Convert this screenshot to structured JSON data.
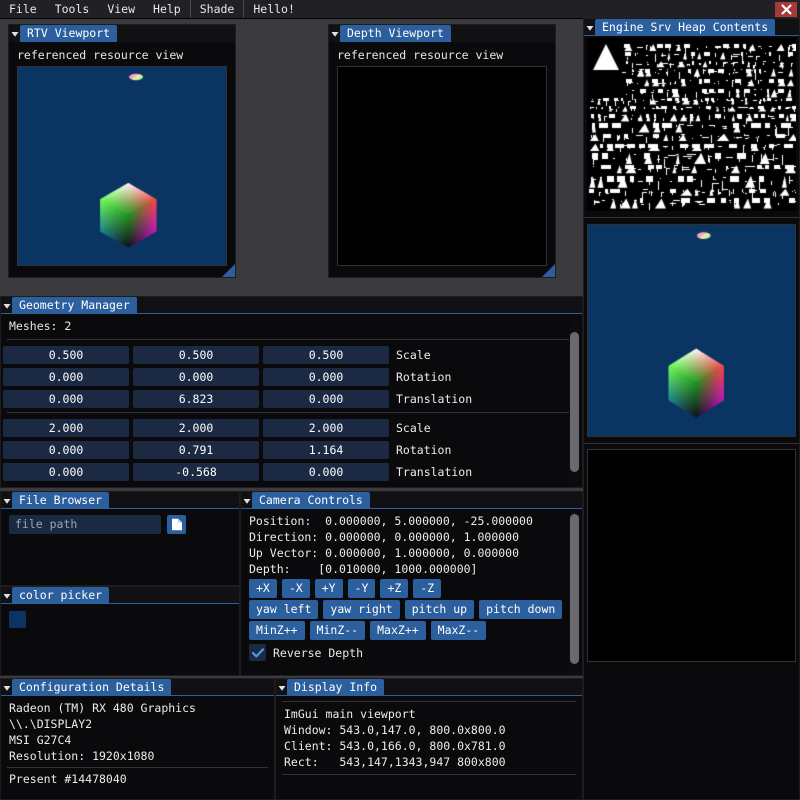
{
  "menubar": {
    "items": [
      {
        "label": "File"
      },
      {
        "label": "Tools"
      },
      {
        "label": "View"
      },
      {
        "label": "Help"
      },
      {
        "label": "Shade"
      },
      {
        "label": "Hello!"
      }
    ],
    "close_glyph": "close-icon"
  },
  "rtv_viewport": {
    "title": "RTV Viewport",
    "label": "referenced resource view"
  },
  "depth_viewport": {
    "title": "Depth Viewport",
    "label": "referenced resource view"
  },
  "geometry_manager": {
    "title": "Geometry Manager",
    "meshes_text": "Meshes: 2",
    "meshes": [
      {
        "rows": [
          {
            "values": [
              "0.500",
              "0.500",
              "0.500"
            ],
            "label": "Scale"
          },
          {
            "values": [
              "0.000",
              "0.000",
              "0.000"
            ],
            "label": "Rotation"
          },
          {
            "values": [
              "0.000",
              "6.823",
              "0.000"
            ],
            "label": "Translation"
          }
        ]
      },
      {
        "rows": [
          {
            "values": [
              "2.000",
              "2.000",
              "2.000"
            ],
            "label": "Scale"
          },
          {
            "values": [
              "0.000",
              "0.791",
              "1.164"
            ],
            "label": "Rotation"
          },
          {
            "values": [
              "0.000",
              "-0.568",
              "0.000"
            ],
            "label": "Translation"
          }
        ]
      }
    ]
  },
  "file_browser": {
    "title": "File Browser",
    "path_value": "file path",
    "browse_icon": "document-icon"
  },
  "color_picker": {
    "title": "color picker",
    "swatch_color": "#0a3563"
  },
  "camera_controls": {
    "title": "Camera Controls",
    "lines": [
      "Position:  0.000000, 5.000000, -25.000000",
      "Direction: 0.000000, 0.000000, 1.000000",
      "Up Vector: 0.000000, 1.000000, 0.000000",
      "Depth:    [0.010000, 1000.000000]"
    ],
    "axis_buttons": [
      "+X",
      "-X",
      "+Y",
      "-Y",
      "+Z",
      "-Z"
    ],
    "rotate_buttons": [
      "yaw left",
      "yaw right",
      "pitch up",
      "pitch down"
    ],
    "depth_buttons": [
      "MinZ++",
      "MinZ--",
      "MaxZ++",
      "MaxZ--"
    ],
    "reverse_depth_label": "Reverse Depth",
    "reverse_depth_checked": true
  },
  "configuration_details": {
    "title": "Configuration Details",
    "lines": [
      "Radeon (TM) RX 480 Graphics",
      "\\\\.\\DISPLAY2",
      "MSI G27C4",
      "Resolution: 1920x1080"
    ],
    "present_line": "Present #14478040"
  },
  "display_info": {
    "title": "Display Info",
    "lines": [
      "ImGui main viewport",
      "Window: 543.0,147.0, 800.0x800.0",
      "Client: 543.0,166.0, 800.0x781.0",
      "Rect:   543,147,1343,947 800x800"
    ]
  },
  "heap_panel": {
    "title": "Engine Srv Heap Contents"
  },
  "theme": {
    "accent": "#2c5f9e",
    "window_bg": "#0a0a0c",
    "viewport_bg": "#0a3563",
    "field_bg": "#1b2a42",
    "desktop_bg": "#3b3b3f",
    "close_red": "#a33b3b"
  }
}
